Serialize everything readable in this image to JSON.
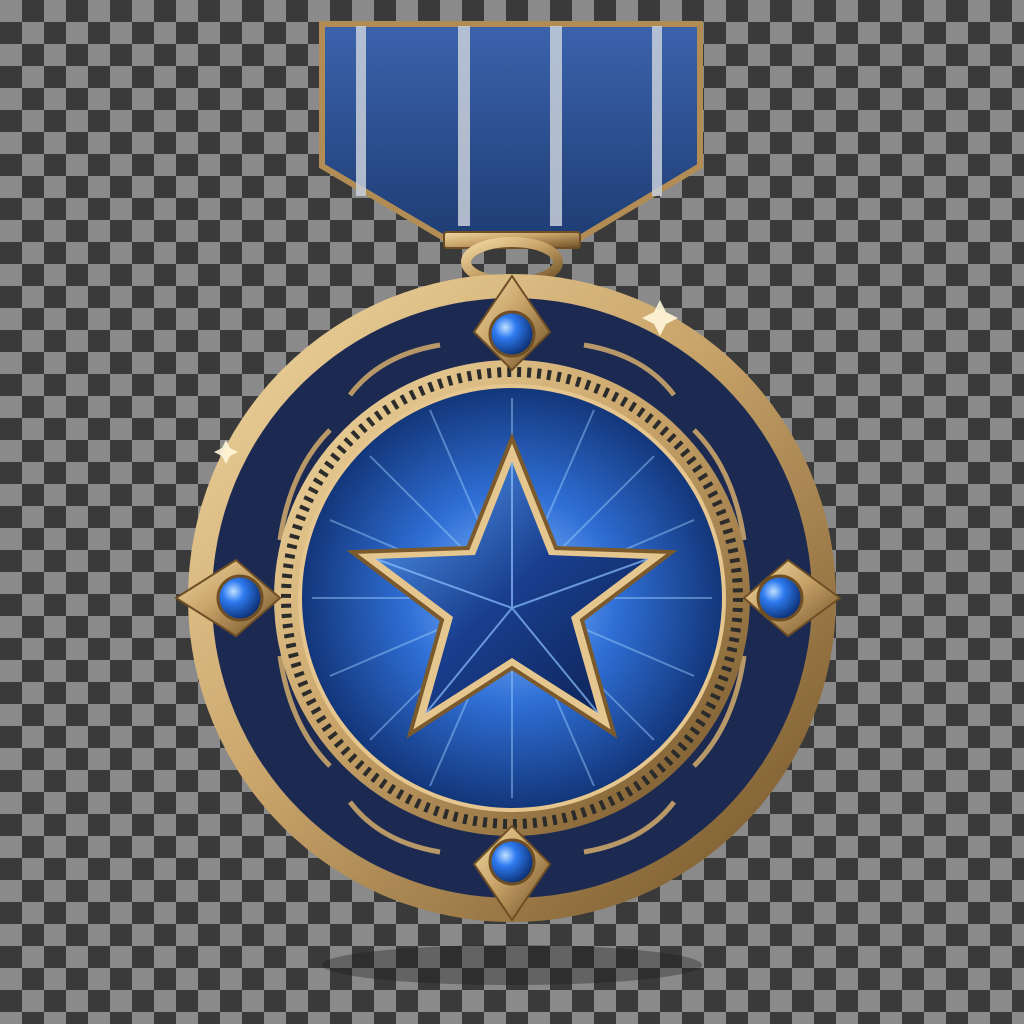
{
  "scene": {
    "subject": "medal-with-ribbon",
    "background": "transparency-checkerboard",
    "colors": {
      "gold": "#c9a46a",
      "gold_dark": "#7a5a2c",
      "gold_light": "#f1d9a2",
      "navy": "#1c2a52",
      "blue": "#2f6fd6",
      "blue_light": "#7fb6ff",
      "ribbon_blue": "#2a4f8f",
      "ribbon_stripe": "#c8cfd9"
    },
    "icons": {
      "center": "star-icon",
      "gems": [
        "gem-top",
        "gem-left",
        "gem-right",
        "gem-bottom"
      ]
    }
  }
}
